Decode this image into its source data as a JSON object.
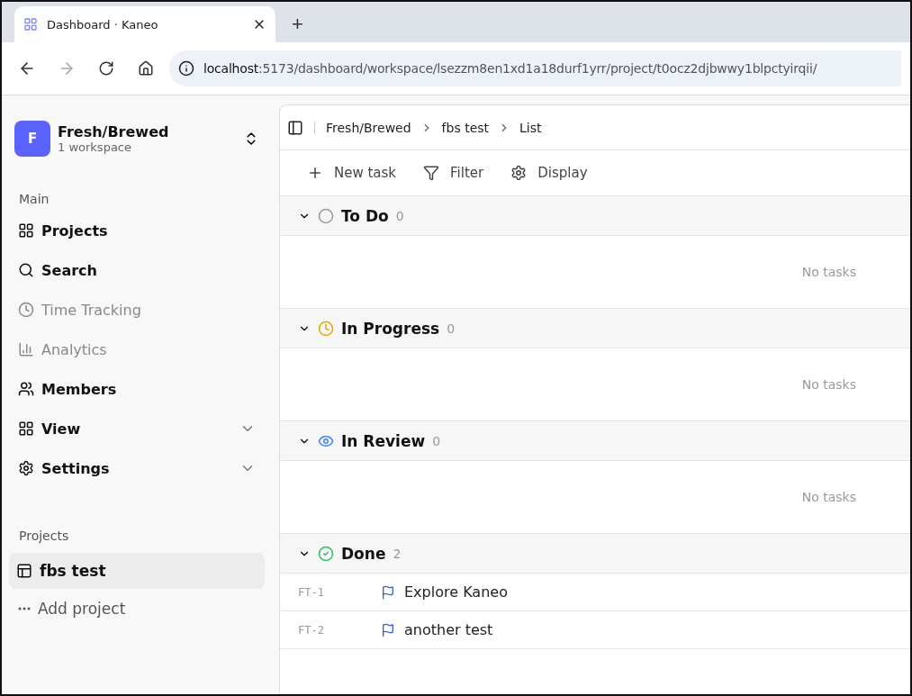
{
  "browser": {
    "tab_title": "Dashboard · Kaneo",
    "new_tab": "+",
    "url_host": "localhost",
    "url_rest": ":5173/dashboard/workspace/lsezzm8en1xd1a18durf1yrr/project/t0ocz2djbwwy1blpctyirqii/"
  },
  "workspace": {
    "initial": "F",
    "name": "Fresh/Brewed",
    "subtitle": "1 workspace"
  },
  "main_heading": "Main",
  "nav": [
    {
      "label": "Projects",
      "kind": "link",
      "disabled": false
    },
    {
      "label": "Search",
      "kind": "link",
      "disabled": false
    },
    {
      "label": "Time Tracking",
      "kind": "link",
      "disabled": true
    },
    {
      "label": "Analytics",
      "kind": "link",
      "disabled": true
    },
    {
      "label": "Members",
      "kind": "link",
      "disabled": false
    },
    {
      "label": "View",
      "kind": "group",
      "disabled": false,
      "expanded": false
    },
    {
      "label": "Settings",
      "kind": "group",
      "disabled": false,
      "expanded": false
    }
  ],
  "projects_heading": "Projects",
  "projects": [
    {
      "label": "fbs test",
      "selected": true
    }
  ],
  "add_project": "Add project",
  "breadcrumbs": [
    "Fresh/Brewed",
    "fbs test",
    "List"
  ],
  "toolbar": [
    "New task",
    "Filter",
    "Display"
  ],
  "sections": [
    {
      "kind": "todo",
      "title": "To Do",
      "count": "0",
      "expanded": true,
      "empty_text": "No tasks"
    },
    {
      "kind": "in_progress",
      "title": "In Progress",
      "count": "0",
      "expanded": true,
      "empty_text": "No tasks"
    },
    {
      "kind": "in_review",
      "title": "In Review",
      "count": "0",
      "expanded": true,
      "empty_text": "No tasks"
    },
    {
      "kind": "done",
      "title": "Done",
      "count": "2",
      "expanded": true,
      "tasks": [
        {
          "id": "FT-1",
          "title": "Explore Kaneo"
        },
        {
          "id": "FT-2",
          "title": "another test"
        }
      ]
    }
  ]
}
